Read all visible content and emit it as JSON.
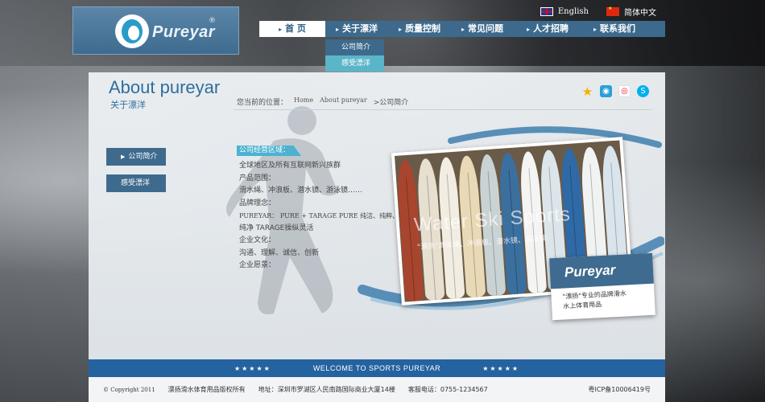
{
  "header": {
    "logo_text": "Pureyar",
    "logo_reg": "®",
    "languages": [
      "English",
      "简体中文"
    ]
  },
  "nav": {
    "items": [
      "首 页",
      "关于漂洋",
      "质量控制",
      "常见问题",
      "人才招聘",
      "联系我们"
    ],
    "dropdown": [
      "公司简介",
      "感受漂洋"
    ]
  },
  "page": {
    "title": "About pureyar",
    "subtitle": "关于漂洋",
    "breadcrumb": {
      "label": "您当前的位置：",
      "home": "Home",
      "about": "About pureyar",
      "current": ">公司简介"
    }
  },
  "sidebar": {
    "items": [
      "公司简介",
      "感受漂洋"
    ]
  },
  "content": {
    "tag": "公司经营区域：",
    "lines": [
      "全球地区及所有互联网新兴族群",
      "产品范围：",
      "滑水绳、冲浪板、潜水镜、游泳镜……",
      "品牌理念：",
      "PUREYAR：  PURE + TARAGE    PURE 纯洁、纯粹、",
      "纯净  TARAGE操纵灵活",
      "企业文化：",
      "沟通、理解、诚信、创新",
      "企业愿景："
    ]
  },
  "showcase": {
    "photo_title": "Water Ski Sports",
    "photo_caption": "\"漂扬\"滑水绳、冲浪板、潜水镜、游泳镜",
    "badge_logo": "Pureyar",
    "badge_lines": [
      "\"漂扬\"专业的品牌滑水",
      "水上体育用品"
    ]
  },
  "footer": {
    "banner": "WELCOME TO SPORTS PUREYAR",
    "stars": "★★★★★",
    "copyright": "© Copyright 2011",
    "owner": "漂扬滑水体育用品版权所有",
    "address": "地址：深圳市罗湖区人民南路国际商业大厦14楼",
    "phone": "客服电话：0755-1234567",
    "icp": "粤ICP备10006419号"
  },
  "colors": {
    "brand_blue": "#3d6a8c",
    "highlight_teal": "#5bb5c8",
    "footer_blue": "#2462a0"
  }
}
